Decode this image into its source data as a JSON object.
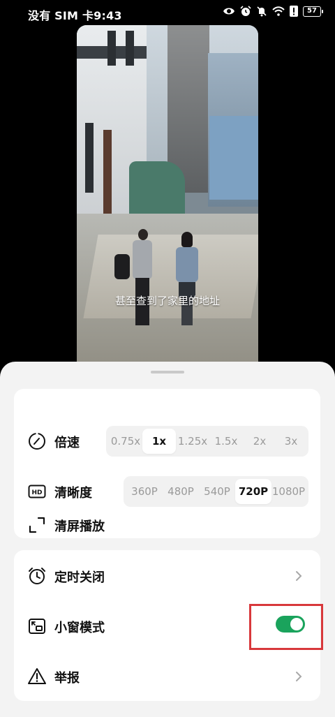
{
  "status_bar": {
    "carrier_time": "没有 SIM 卡9:43",
    "battery_level": "57",
    "icons": [
      "eye-icon",
      "alarm-icon",
      "mute-icon",
      "wifi-icon",
      "alert-icon",
      "battery-icon"
    ]
  },
  "video": {
    "subtitle": "甚至查到了家里的地址"
  },
  "settings": {
    "speed": {
      "label": "倍速",
      "icon": "speed-dial-icon",
      "options": [
        "0.75x",
        "1x",
        "1.25x",
        "1.5x",
        "2x",
        "3x"
      ],
      "selected": "1x"
    },
    "quality": {
      "label": "清晰度",
      "icon": "hd-icon",
      "options": [
        "360P",
        "480P",
        "540P",
        "720P",
        "1080P"
      ],
      "selected": "720P"
    },
    "clear_screen": {
      "label": "清屏播放",
      "icon": "fullscreen-corners-icon"
    },
    "timer_close": {
      "label": "定时关闭",
      "icon": "alarm-clock-icon"
    },
    "mini_window": {
      "label": "小窗模式",
      "icon": "picture-in-picture-icon",
      "enabled": true
    },
    "report": {
      "label": "举报",
      "icon": "warning-icon"
    }
  },
  "colors": {
    "toggle_on": "#1aa35c",
    "highlight": "#d8383b",
    "sheet_bg": "#f3f3f3"
  }
}
